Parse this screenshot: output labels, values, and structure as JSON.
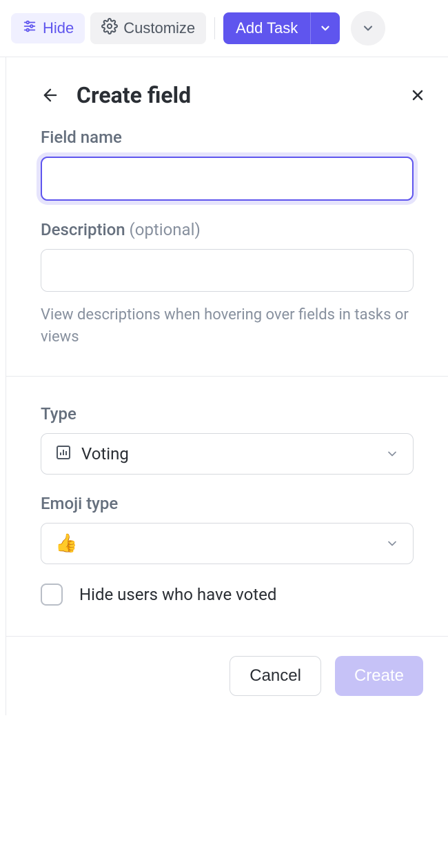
{
  "toolbar": {
    "hide_label": "Hide",
    "customize_label": "Customize",
    "add_task_label": "Add Task"
  },
  "panel": {
    "title": "Create field"
  },
  "form": {
    "field_name_label": "Field name",
    "field_name_value": "",
    "description_label": "Description",
    "description_optional": "(optional)",
    "description_value": "",
    "description_helper": "View descriptions when hovering over fields in tasks or views",
    "type_label": "Type",
    "type_value": "Voting",
    "emoji_type_label": "Emoji type",
    "emoji_value": "👍",
    "hide_voters_label": "Hide users who have voted",
    "hide_voters_checked": false
  },
  "footer": {
    "cancel_label": "Cancel",
    "create_label": "Create"
  }
}
